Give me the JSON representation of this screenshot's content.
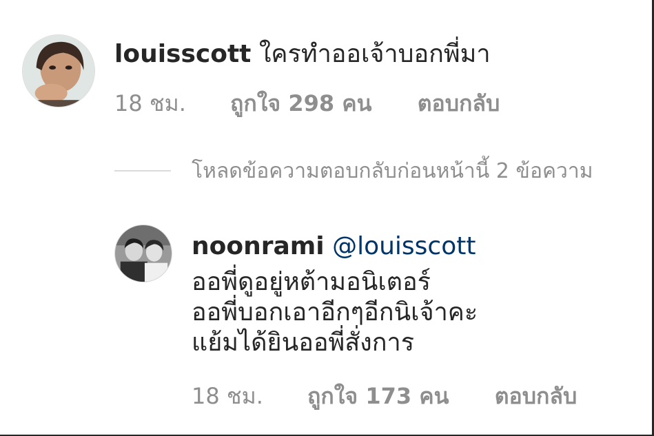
{
  "comment": {
    "username": "louisscott",
    "text": "ใครทำออเจ้าบอกพี่มา",
    "time": "18 ชม.",
    "likes": "ถูกใจ 298 คน",
    "reply_label": "ตอบกลับ"
  },
  "load_previous": "โหลดข้อความตอบกลับก่อนหน้านี้ 2 ข้อความ",
  "reply": {
    "username": "noonrami",
    "mention": "@louisscott",
    "lines": [
      "ออพี่ดูอยู่หต้ามอนิเตอร์",
      "ออพี่บอกเอาอีกๆอีกนิเจ้าคะ",
      "แย้มได้ยินออพี่สั่งการ"
    ],
    "time": "18 ชม.",
    "likes": "ถูกใจ 173 คน",
    "reply_label": "ตอบกลับ"
  },
  "colors": {
    "text": "#262626",
    "meta": "#8e8e8e",
    "mention": "#003569",
    "divider": "#dbdbdb"
  }
}
